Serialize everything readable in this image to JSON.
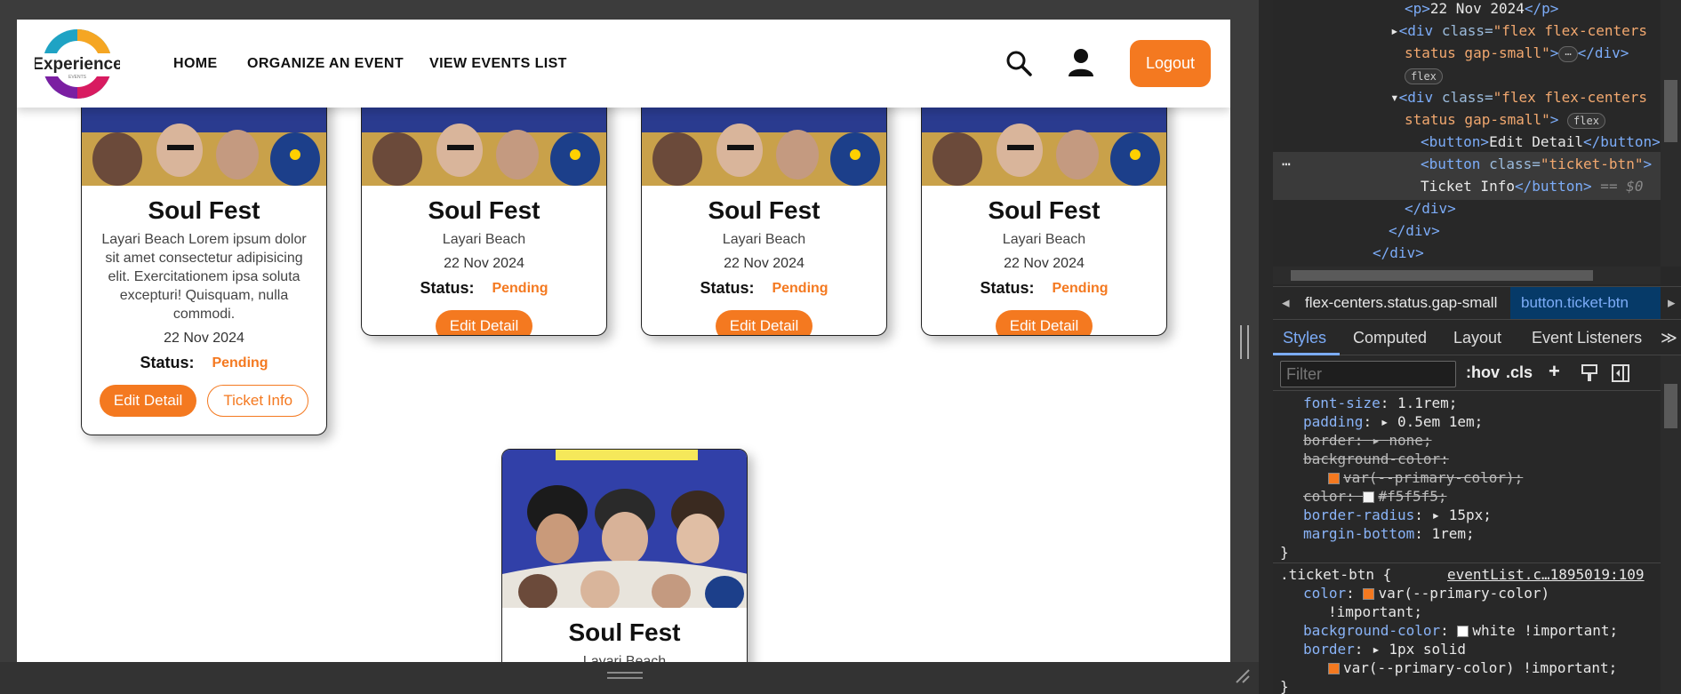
{
  "site": {
    "logo_text": "Experience",
    "logo_sub": "EVENTS",
    "nav": [
      "HOME",
      "ORGANIZE AN EVENT",
      "VIEW EVENTS LIST"
    ],
    "logout_label": "Logout"
  },
  "cards": [
    {
      "title": "Soul Fest",
      "desc": "Layari Beach Lorem ipsum dolor sit amet consectetur adipisicing elit. Exercitationem ipsa soluta excepturi! Quisquam, nulla commodi.",
      "date": "22 Nov 2024",
      "status_label": "Status:",
      "status_value": "Pending",
      "edit_label": "Edit Detail",
      "ticket_label": "Ticket Info"
    },
    {
      "title": "Soul Fest",
      "desc": "Layari Beach",
      "date": "22 Nov 2024",
      "status_label": "Status:",
      "status_value": "Pending",
      "edit_label": "Edit Detail"
    },
    {
      "title": "Soul Fest",
      "desc": "Layari Beach",
      "date": "22 Nov 2024",
      "status_label": "Status:",
      "status_value": "Pending",
      "edit_label": "Edit Detail"
    },
    {
      "title": "Soul Fest",
      "desc": "Layari Beach",
      "date": "22 Nov 2024",
      "status_label": "Status:",
      "status_value": "Pending",
      "edit_label": "Edit Detail"
    },
    {
      "title": "Soul Fest",
      "desc": "Layari Beach"
    }
  ],
  "devtools": {
    "dom": {
      "l1_open": "<p>",
      "l1_text": "22 Nov 2024",
      "l1_close": "</p>",
      "l2_tag": "<div ",
      "l2_attr": "class=",
      "l2_val": "\"flex flex-centers",
      "l3_val": "status gap-small\"",
      "l3_end": ">",
      "l3_ellipsis": "⋯",
      "l3_close": "</div>",
      "flex_badge": "flex",
      "l5_tag": "<div ",
      "l5_attr": "class=",
      "l5_val": "\"flex flex-centers",
      "l6_val": "status gap-small\"",
      "l6_end": ">",
      "l7_open": "<button>",
      "l7_text": "Edit Detail",
      "l7_close": "</button>",
      "l8_tag": "<button ",
      "l8_attr": "class=",
      "l8_val": "\"ticket-btn\"",
      "l8_end": ">",
      "l9_text": "Ticket Info",
      "l9_close": "</button>",
      "l9_ref": " == $0",
      "close_div": "</div>",
      "gutter_dots": "⋯"
    },
    "breadcrumbs": [
      "flex-centers.status.gap-small",
      "button.ticket-btn"
    ],
    "tabs": [
      "Styles",
      "Computed",
      "Layout",
      "Event Listeners"
    ],
    "tab_more": "≫",
    "filter_placeholder": "Filter",
    "toolbar": {
      "hov": ":hov",
      "cls": ".cls",
      "plus": "+"
    },
    "css": {
      "r1_prop": "font-size",
      "r1_val": "1.1rem;",
      "r2_prop": "padding",
      "r2_val": "0.5em 1em;",
      "r3_prop": "border",
      "r3_val": "none;",
      "r4_prop": "background-color",
      "r5_val": "var(--primary-color);",
      "r6_prop": "color",
      "r6_val": "#f5f5f5;",
      "r7_prop": "border-radius",
      "r7_val": "15px;",
      "r8_prop": "margin-bottom",
      "r8_val": "1rem;",
      "close_brace": "}",
      "selector": ".ticket-btn {",
      "source": "eventList.c…1895019:109",
      "t1_prop": "color",
      "t1_val": "var(--primary-color)",
      "t1b": "!important;",
      "t2_prop": "background-color",
      "t2_val": "white !important;",
      "t3_prop": "border",
      "t3_val": "1px solid",
      "t4_val": "var(--primary-color) !important;"
    },
    "colors": {
      "primary": "#f47920",
      "whitesmoke": "#f5f5f5",
      "white": "#ffffff"
    }
  }
}
